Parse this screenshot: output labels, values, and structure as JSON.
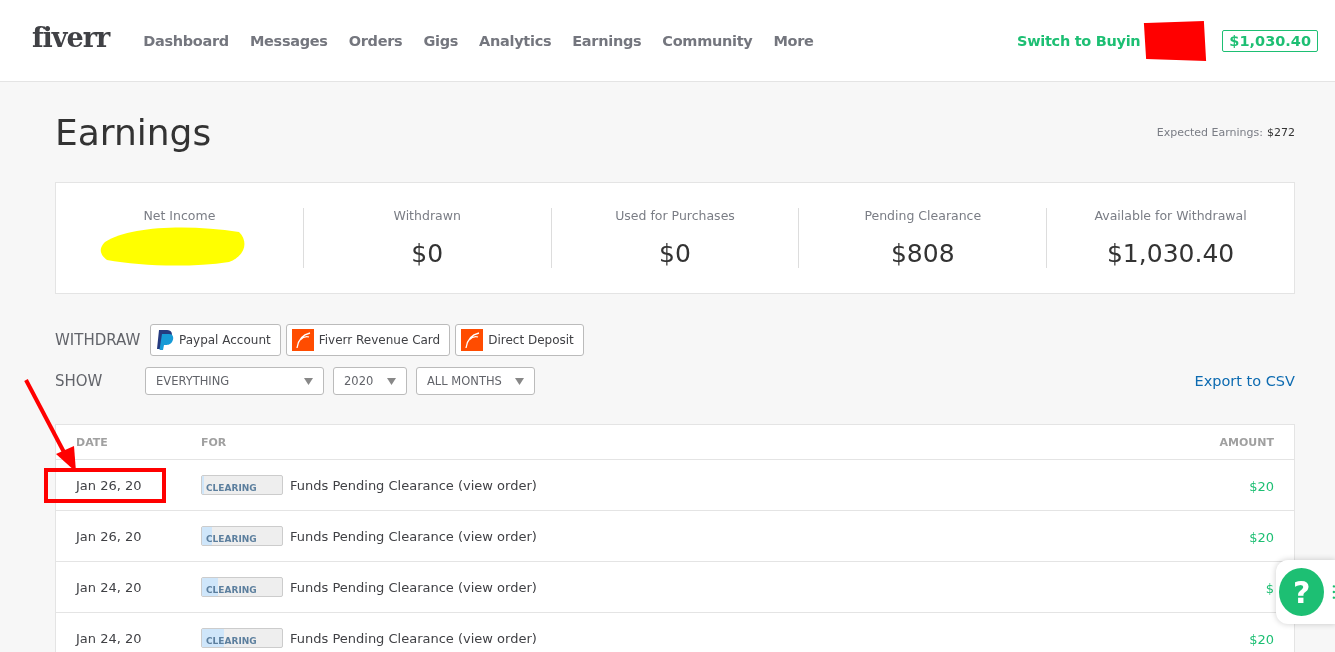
{
  "header": {
    "logo": "fiverr",
    "nav": [
      {
        "label": "Dashboard"
      },
      {
        "label": "Messages"
      },
      {
        "label": "Orders"
      },
      {
        "label": "Gigs"
      },
      {
        "label": "Analytics"
      },
      {
        "label": "Earnings"
      },
      {
        "label": "Community"
      },
      {
        "label": "More"
      }
    ],
    "switch_link": "Switch to Buyin",
    "balance": "$1,030.40"
  },
  "title": "Earnings",
  "expected": {
    "label": "Expected Earnings:",
    "value": "$272"
  },
  "stats": [
    {
      "label": "Net Income",
      "redacted": true
    },
    {
      "label": "Withdrawn",
      "value": "$0"
    },
    {
      "label": "Used for Purchases",
      "value": "$0"
    },
    {
      "label": "Pending Clearance",
      "value": "$808"
    },
    {
      "label": "Available for Withdrawal",
      "value": "$1,030.40"
    }
  ],
  "withdraw": {
    "label": "WITHDRAW",
    "options": [
      {
        "label": "Paypal Account",
        "kind": "paypal"
      },
      {
        "label": "Fiverr Revenue Card",
        "kind": "fiverr"
      },
      {
        "label": "Direct Deposit",
        "kind": "fiverr"
      }
    ]
  },
  "show": {
    "label": "SHOW",
    "filters": [
      {
        "value": "EVERYTHING"
      },
      {
        "value": "2020"
      },
      {
        "value": "ALL MONTHS"
      }
    ],
    "export": "Export to CSV"
  },
  "table": {
    "columns": [
      "DATE",
      "FOR",
      "AMOUNT"
    ],
    "rows": [
      {
        "date": "Jan 26, 20",
        "status": "CLEARING",
        "level": 0.03,
        "description": "Funds Pending Clearance (view order)",
        "amount": "$20",
        "highlighted": true
      },
      {
        "date": "Jan 26, 20",
        "status": "CLEARING",
        "level": 0.12,
        "description": "Funds Pending Clearance (view order)",
        "amount": "$20",
        "highlighted": false
      },
      {
        "date": "Jan 24, 20",
        "status": "CLEARING",
        "level": 0.2,
        "description": "Funds Pending Clearance (view order)",
        "amount": "$",
        "highlighted": false
      },
      {
        "date": "Jan 24, 20",
        "status": "CLEARING",
        "level": 0.27,
        "description": "Funds Pending Clearance (view order)",
        "amount": "$20",
        "highlighted": false
      }
    ]
  },
  "help": {
    "label": "?"
  }
}
